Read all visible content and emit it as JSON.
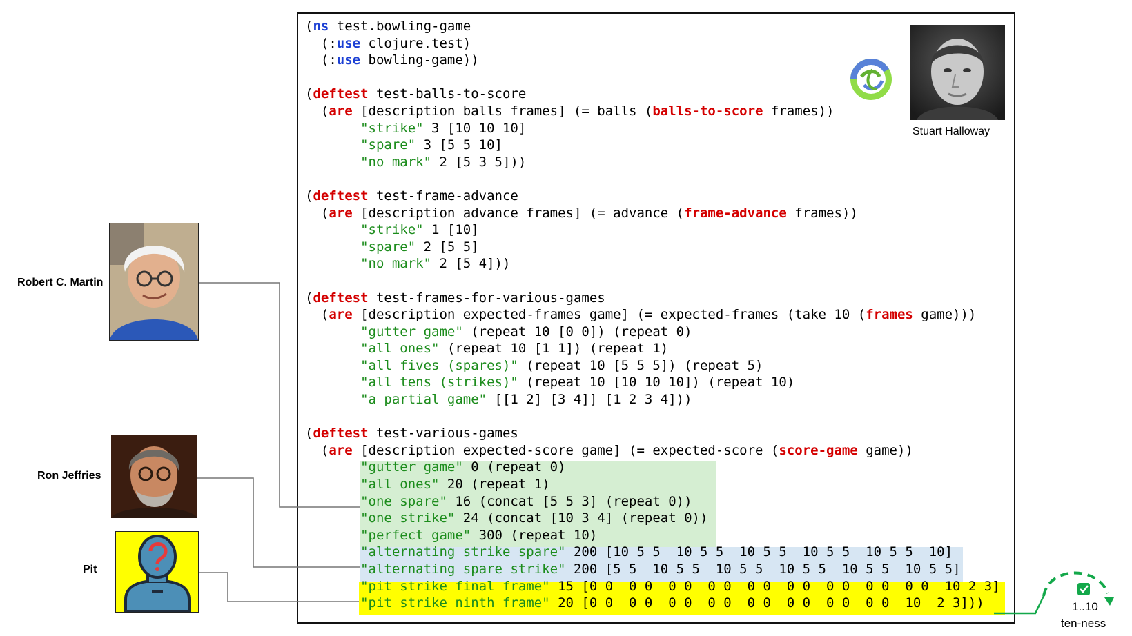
{
  "code_lines": [
    [
      {
        "t": "(",
        "c": "plain"
      },
      {
        "t": "ns",
        "c": "kw"
      },
      {
        "t": " test.bowling-game",
        "c": "plain"
      }
    ],
    [
      {
        "t": "  (:",
        "c": "plain"
      },
      {
        "t": "use",
        "c": "kw"
      },
      {
        "t": " clojure.test)",
        "c": "plain"
      }
    ],
    [
      {
        "t": "  (:",
        "c": "plain"
      },
      {
        "t": "use",
        "c": "kw"
      },
      {
        "t": " bowling-game))",
        "c": "plain"
      }
    ],
    [],
    [
      {
        "t": "(",
        "c": "plain"
      },
      {
        "t": "deftest",
        "c": "fn"
      },
      {
        "t": " test-balls-to-score",
        "c": "plain"
      }
    ],
    [
      {
        "t": "  (",
        "c": "plain"
      },
      {
        "t": "are",
        "c": "fn"
      },
      {
        "t": " [description balls frames] (= balls (",
        "c": "plain"
      },
      {
        "t": "balls-to-score",
        "c": "fn"
      },
      {
        "t": " frames))",
        "c": "plain"
      }
    ],
    [
      {
        "t": "       ",
        "c": "plain"
      },
      {
        "t": "\"strike\"",
        "c": "str"
      },
      {
        "t": " 3 [10 10 10]",
        "c": "plain"
      }
    ],
    [
      {
        "t": "       ",
        "c": "plain"
      },
      {
        "t": "\"spare\"",
        "c": "str"
      },
      {
        "t": " 3 [5 5 10]",
        "c": "plain"
      }
    ],
    [
      {
        "t": "       ",
        "c": "plain"
      },
      {
        "t": "\"no mark\"",
        "c": "str"
      },
      {
        "t": " 2 [5 3 5]))",
        "c": "plain"
      }
    ],
    [],
    [
      {
        "t": "(",
        "c": "plain"
      },
      {
        "t": "deftest",
        "c": "fn"
      },
      {
        "t": " test-frame-advance",
        "c": "plain"
      }
    ],
    [
      {
        "t": "  (",
        "c": "plain"
      },
      {
        "t": "are",
        "c": "fn"
      },
      {
        "t": " [description advance frames] (= advance (",
        "c": "plain"
      },
      {
        "t": "frame-advance",
        "c": "fn"
      },
      {
        "t": " frames))",
        "c": "plain"
      }
    ],
    [
      {
        "t": "       ",
        "c": "plain"
      },
      {
        "t": "\"strike\"",
        "c": "str"
      },
      {
        "t": " 1 [10]",
        "c": "plain"
      }
    ],
    [
      {
        "t": "       ",
        "c": "plain"
      },
      {
        "t": "\"spare\"",
        "c": "str"
      },
      {
        "t": " 2 [5 5]",
        "c": "plain"
      }
    ],
    [
      {
        "t": "       ",
        "c": "plain"
      },
      {
        "t": "\"no mark\"",
        "c": "str"
      },
      {
        "t": " 2 [5 4]))",
        "c": "plain"
      }
    ],
    [],
    [
      {
        "t": "(",
        "c": "plain"
      },
      {
        "t": "deftest",
        "c": "fn"
      },
      {
        "t": " test-frames-for-various-games",
        "c": "plain"
      }
    ],
    [
      {
        "t": "  (",
        "c": "plain"
      },
      {
        "t": "are",
        "c": "fn"
      },
      {
        "t": " [description expected-frames game] (= expected-frames (take 10 (",
        "c": "plain"
      },
      {
        "t": "frames",
        "c": "fn"
      },
      {
        "t": " game)))",
        "c": "plain"
      }
    ],
    [
      {
        "t": "       ",
        "c": "plain"
      },
      {
        "t": "\"gutter game\"",
        "c": "str"
      },
      {
        "t": " (repeat 10 [0 0]) (repeat 0)",
        "c": "plain"
      }
    ],
    [
      {
        "t": "       ",
        "c": "plain"
      },
      {
        "t": "\"all ones\"",
        "c": "str"
      },
      {
        "t": " (repeat 10 [1 1]) (repeat 1)",
        "c": "plain"
      }
    ],
    [
      {
        "t": "       ",
        "c": "plain"
      },
      {
        "t": "\"all fives (spares)\"",
        "c": "str"
      },
      {
        "t": " (repeat 10 [5 5 5]) (repeat 5)",
        "c": "plain"
      }
    ],
    [
      {
        "t": "       ",
        "c": "plain"
      },
      {
        "t": "\"all tens (strikes)\"",
        "c": "str"
      },
      {
        "t": " (repeat 10 [10 10 10]) (repeat 10)",
        "c": "plain"
      }
    ],
    [
      {
        "t": "       ",
        "c": "plain"
      },
      {
        "t": "\"a partial game\"",
        "c": "str"
      },
      {
        "t": " [[1 2] [3 4]] [1 2 3 4]))",
        "c": "plain"
      }
    ],
    [],
    [
      {
        "t": "(",
        "c": "plain"
      },
      {
        "t": "deftest",
        "c": "fn"
      },
      {
        "t": " test-various-games",
        "c": "plain"
      }
    ],
    [
      {
        "t": "  (",
        "c": "plain"
      },
      {
        "t": "are",
        "c": "fn"
      },
      {
        "t": " [description expected-score game] (= expected-score (",
        "c": "plain"
      },
      {
        "t": "score-game",
        "c": "fn"
      },
      {
        "t": " game))",
        "c": "plain"
      }
    ],
    [
      {
        "t": "       ",
        "c": "plain"
      },
      {
        "t": "\"gutter game\"",
        "c": "str"
      },
      {
        "t": " 0 (repeat 0)",
        "c": "plain"
      }
    ],
    [
      {
        "t": "       ",
        "c": "plain"
      },
      {
        "t": "\"all ones\"",
        "c": "str"
      },
      {
        "t": " 20 (repeat 1)",
        "c": "plain"
      }
    ],
    [
      {
        "t": "       ",
        "c": "plain"
      },
      {
        "t": "\"one spare\"",
        "c": "str"
      },
      {
        "t": " 16 (concat [5 5 3] (repeat 0))",
        "c": "plain"
      }
    ],
    [
      {
        "t": "       ",
        "c": "plain"
      },
      {
        "t": "\"one strike\"",
        "c": "str"
      },
      {
        "t": " 24 (concat [10 3 4] (repeat 0))",
        "c": "plain"
      }
    ],
    [
      {
        "t": "       ",
        "c": "plain"
      },
      {
        "t": "\"perfect game\"",
        "c": "str"
      },
      {
        "t": " 300 (repeat 10)",
        "c": "plain"
      }
    ],
    [
      {
        "t": "       ",
        "c": "plain"
      },
      {
        "t": "\"alternating strike spare\"",
        "c": "str"
      },
      {
        "t": " 200 [10 5 5  10 5 5  10 5 5  10 5 5  10 5 5  10]",
        "c": "plain"
      }
    ],
    [
      {
        "t": "       ",
        "c": "plain"
      },
      {
        "t": "\"alternating spare strike\"",
        "c": "str"
      },
      {
        "t": " 200 [5 5  10 5 5  10 5 5  10 5 5  10 5 5  10 5 5]",
        "c": "plain"
      }
    ],
    [
      {
        "t": "       ",
        "c": "plain"
      },
      {
        "t": "\"pit strike final frame\"",
        "c": "str"
      },
      {
        "t": " 15 [0 0  0 0  0 0  0 0  0 0  0 0  0 0  0 0  0 0  10 2 3]",
        "c": "plain"
      }
    ],
    [
      {
        "t": "       ",
        "c": "plain"
      },
      {
        "t": "\"pit strike ninth frame\"",
        "c": "str"
      },
      {
        "t": " 20 [0 0  0 0  0 0  0 0  0 0  0 0  0 0  0 0  10  2 3]))",
        "c": "plain"
      }
    ]
  ],
  "people": {
    "robert": {
      "label": "Robert C. Martin"
    },
    "ron": {
      "label": "Ron Jeffries"
    },
    "pit": {
      "label": "Pit"
    },
    "stuart": {
      "label": "Stuart Halloway"
    }
  },
  "annotation": {
    "range": "1..10",
    "caption": "ten-ness",
    "check": "✓"
  },
  "colors": {
    "keyword_blue": "#1b3fd4",
    "keyword_red": "#d40000",
    "string_green": "#1c8c1c",
    "highlight_green": "#d5eed2",
    "highlight_blue": "#d7e6f3",
    "highlight_yellow": "#ffff00",
    "annotation_green": "#13a84a"
  },
  "icons": {
    "logo": "clojure-logo-icon",
    "pit": "unknown-person-icon",
    "check": "check-icon"
  }
}
